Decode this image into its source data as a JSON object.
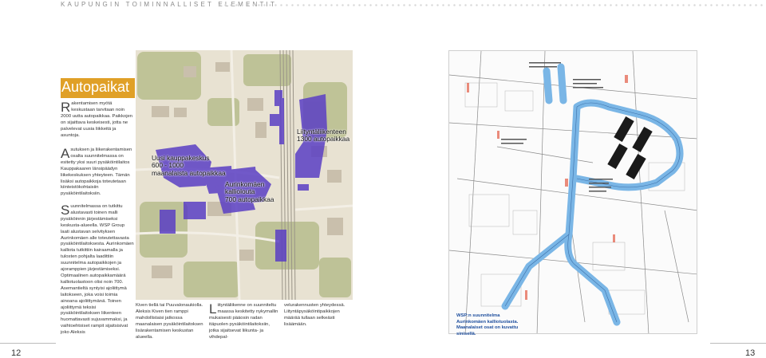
{
  "header": {
    "title": "KAUPUNGIN TOIMINNALLISET ELEMENTIT"
  },
  "section": {
    "title": "Autopaikat"
  },
  "paragraphs": {
    "p1_cap": "R",
    "p1": "akentamisen myötä keskustaan tarvitaan noin 2000 uutta autopaikkaa. Paikkojen on sijaittava keskeisesti, jotta ne palvelevat uusia liikkeitä ja asuntoja.",
    "p2_cap": "A",
    "p2": "sutuksen ja liikerakentamisen osalta suunnitelmassa on esitetty yksi suuri pysäköintilaitos Kauppakaaren länsipäädyn liikekeskuksen yhteyteen. Tämän lisäksi autopaikkoja toteutetaan kiinteistökohtaisiin pysäköintilaitoksiin.",
    "p3_cap": "S",
    "p3": "uunnitelmassa on tutkittu alustavasti toinen malli pysäköinnin järjestämiseksi keskusta-alueella. WSP Group laati alustavan selvityksen Aurinkomäen alle toteutettavasta pysäköintilaitoksesta. Aurinkomäen kalliota tutkittiin kairaamalla ja tulosten pohjalta laadittiin suunnitelma autopaikkojen ja ajoramppien järjestämiseksi. Optimaalinen autopaikkamäärä kalliotuolastoon olisi noin 700. Asemantieltä syntyisi ajoliittymä laitokseen, joka voisi toimia ainoana ajoliittymänä. Toinen ajoliittymä teksisi pysäköintilaitoksen liikenteen huomattavasti sujuvammaksi, ja vaihtoehtoiset rampit sijaitsisivat joko Aleksis"
  },
  "map_labels": {
    "label1": "Uusi kauppakeskus\n600 - 1000\nmaanalaista autopaikkaa",
    "label2": "Aurinkomäen\nkalliolouta\n700 autopaikkaa",
    "label3": "Liityntäliikenteen\n1300 autopaikkaa"
  },
  "columns": {
    "col1": "Kiven tiellä tai Puuvalonaukiolla. Aleksis Kiven tien ramppi mahdollistaisi jatkossa maanalaisen pysäköintilaitoksen lisärakentamisen keskustan alueella.",
    "col2_cap": "L",
    "col2": "iityntäliikenne on suunniteltu maassa keskitetty nykymallin mukaisesti pääosin radan itäpuolen pysäköintilaitoksiin, jotka sijaitsevat liikunta- ja vihdepal-",
    "col3": "velurakennusten yhteydessä. Liityntäpysäköintipaikkojen määrää tullaan selkeästi lisäämään."
  },
  "caption": {
    "text": "WSP:n suunnitelma Aurinkomäen kalliotuolasta. Maanalaiset osat on kuvattu sinisellä."
  },
  "page_numbers": {
    "left": "12",
    "right": "13"
  },
  "colors": {
    "accent": "#e0a027",
    "parking": "#5b3fc4",
    "tunnel": "#7ab6e6"
  }
}
